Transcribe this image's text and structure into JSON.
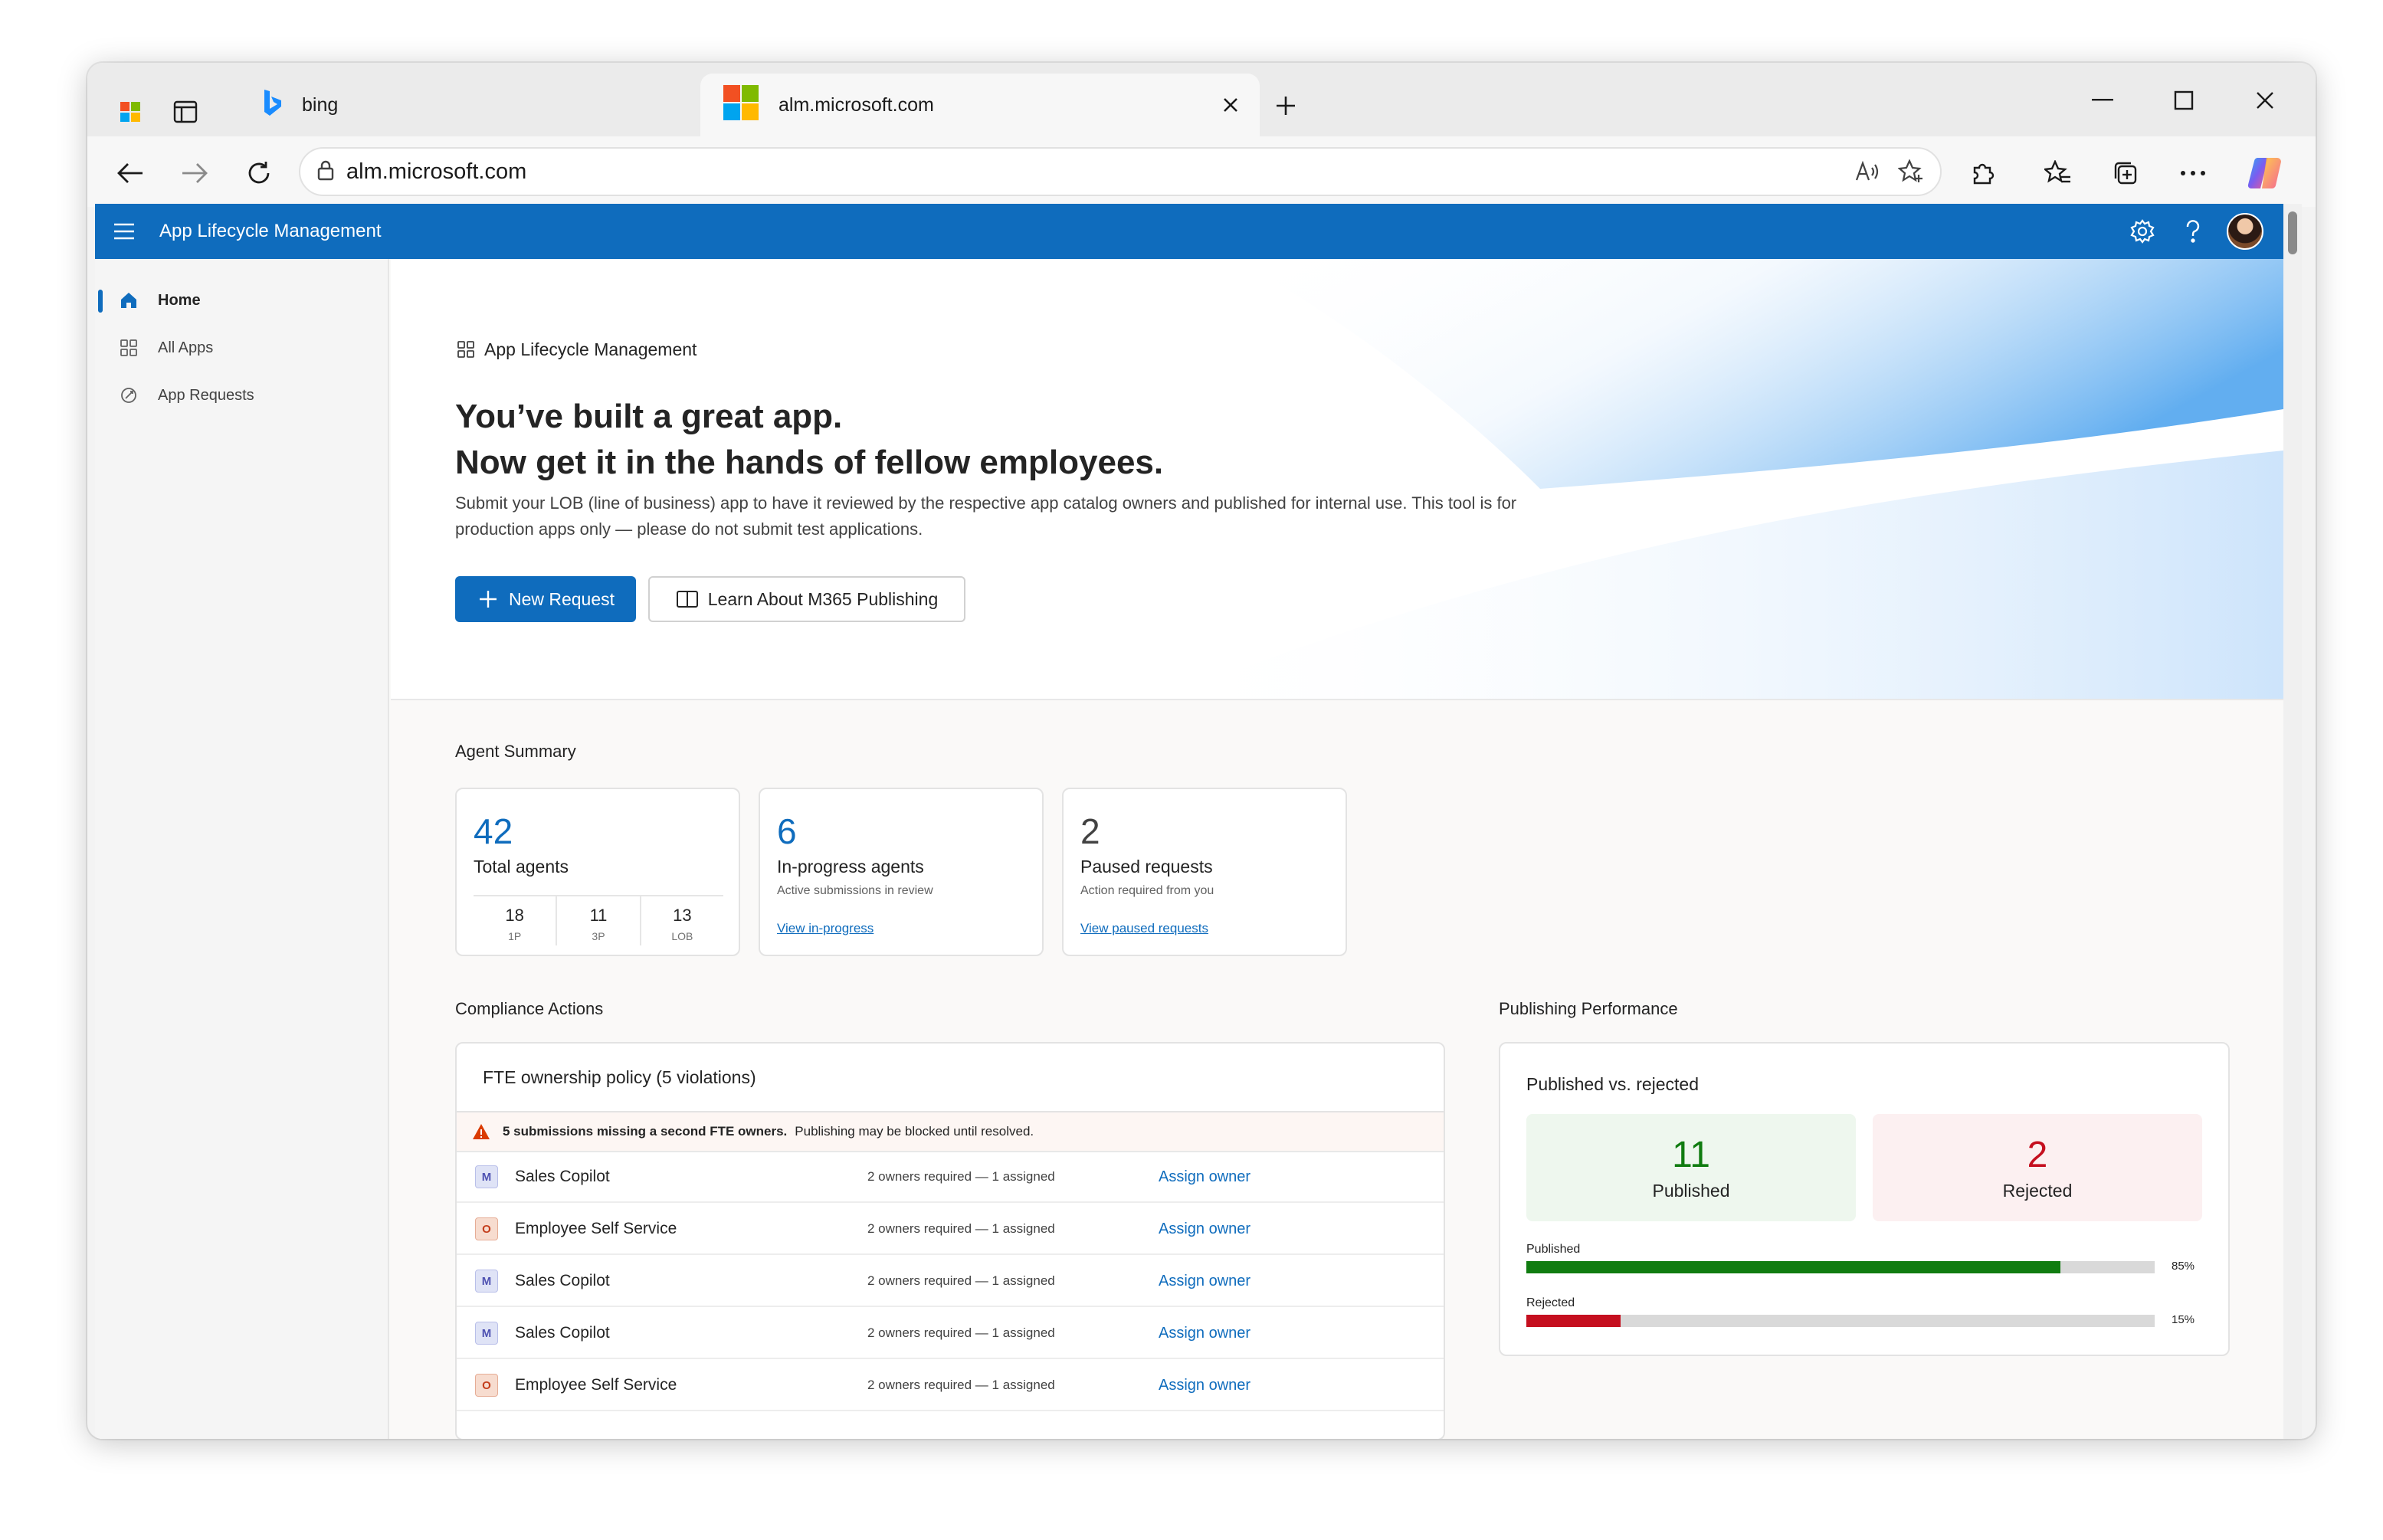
{
  "browser": {
    "tabs": [
      {
        "title": "bing",
        "active": false
      },
      {
        "title": "alm.microsoft.com",
        "active": true
      }
    ],
    "address": "alm.microsoft.com"
  },
  "app": {
    "title": "App Lifecycle Management"
  },
  "sidebar": {
    "items": [
      {
        "label": "Home",
        "icon": "home-icon",
        "active": true
      },
      {
        "label": "All Apps",
        "icon": "apps-grid-icon",
        "active": false
      },
      {
        "label": "App Requests",
        "icon": "request-icon",
        "active": false
      }
    ]
  },
  "hero": {
    "breadcrumb": "App Lifecycle Management",
    "headline_line1": "You’ve built a great app.",
    "headline_line2": "Now get it in the hands of fellow employees.",
    "description": "Submit your LOB (line of business) app to have it reviewed by the respective app catalog owners and published for internal use. This tool is for production apps only — please do not submit test applications.",
    "primary_button": "New Request",
    "secondary_button": "Learn About M365 Publishing"
  },
  "summary": {
    "title": "Agent Summary",
    "total": {
      "value": "42",
      "label": "Total agents",
      "breakdown": [
        {
          "value": "18",
          "label": "1P"
        },
        {
          "value": "11",
          "label": "3P"
        },
        {
          "value": "13",
          "label": "LOB"
        }
      ]
    },
    "in_progress": {
      "value": "6",
      "label": "In-progress agents",
      "sub": "Active submissions in review",
      "link": "View in-progress"
    },
    "paused": {
      "value": "2",
      "label": "Paused requests",
      "sub": "Action required from you",
      "link": "View paused requests"
    }
  },
  "compliance": {
    "title": "Compliance Actions",
    "policy": "FTE ownership policy (5 violations)",
    "warning_bold": "5 submissions missing a second FTE owners.",
    "warning_text": "Publishing may be blocked until resolved.",
    "rows": [
      {
        "name": "Sales Copilot",
        "icon": "M",
        "type": "m",
        "requirement": "2 owners required — 1 assigned",
        "action": "Assign owner"
      },
      {
        "name": "Employee Self Service",
        "icon": "O",
        "type": "o",
        "requirement": "2 owners required — 1 assigned",
        "action": "Assign owner"
      },
      {
        "name": "Sales Copilot",
        "icon": "M",
        "type": "m",
        "requirement": "2 owners required — 1 assigned",
        "action": "Assign owner"
      },
      {
        "name": "Sales Copilot",
        "icon": "M",
        "type": "m",
        "requirement": "2 owners required — 1 assigned",
        "action": "Assign owner"
      },
      {
        "name": "Employee Self Service",
        "icon": "O",
        "type": "o",
        "requirement": "2 owners required — 1 assigned",
        "action": "Assign owner"
      }
    ]
  },
  "publishing": {
    "title": "Publishing Performance",
    "subtitle": "Published vs. rejected",
    "published": {
      "value": "11",
      "label": "Published"
    },
    "rejected": {
      "value": "2",
      "label": "Rejected"
    },
    "bars": [
      {
        "label": "Published",
        "percent": 85,
        "percent_text": "85%",
        "color": "#107c10"
      },
      {
        "label": "Rejected",
        "percent": 15,
        "percent_text": "15%",
        "color": "#c50f1f"
      }
    ]
  },
  "colors": {
    "brand": "#0f6cbd",
    "success": "#107c10",
    "danger": "#c50f1f"
  }
}
